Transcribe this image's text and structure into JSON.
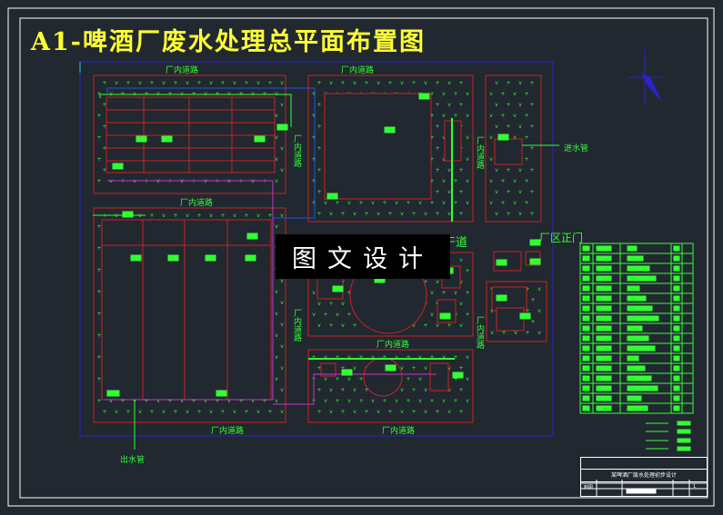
{
  "title": "A1-啤酒厂废水处理总平面布置图",
  "watermark": "图文设计",
  "labels": {
    "road": "厂内道路",
    "inlet_pipe": "进水管",
    "outlet_pipe": "出水管",
    "main_gate": "厂区正门",
    "main_road": "干道"
  },
  "title_block": {
    "project_name": "某啤酒厂废水处理初步设计",
    "drawn_label": "制图",
    "sheet_no": "1"
  },
  "colors": {
    "background": "#212830",
    "title": "#ffff33",
    "structure": "#cc2222",
    "annotation": "#33ff33",
    "boundary": "#2a22cc",
    "pipe": "#cc33cc"
  }
}
